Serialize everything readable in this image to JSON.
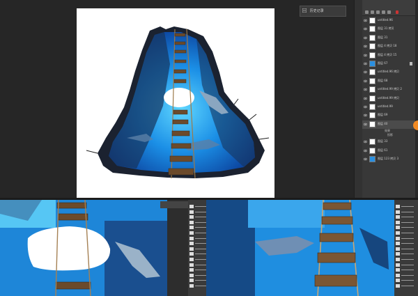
{
  "history_panel": {
    "label": "历史记录",
    "icon": "history-icon"
  },
  "layers": [
    {
      "name": "untitled.96",
      "thumb": "white",
      "selected": false,
      "lock": false
    },
    {
      "name": "图层 31 拷贝",
      "thumb": "white",
      "selected": false,
      "lock": false
    },
    {
      "name": "图层 31",
      "thumb": "white",
      "selected": false,
      "lock": false
    },
    {
      "name": "图层 4 拷贝 18",
      "thumb": "white",
      "selected": false,
      "lock": false
    },
    {
      "name": "图层 4 拷贝 15",
      "thumb": "white",
      "selected": false,
      "lock": false
    },
    {
      "name": "图层 67",
      "thumb": "blue",
      "selected": false,
      "lock": true
    },
    {
      "name": "untitled.96 拷贝",
      "thumb": "white",
      "selected": false,
      "lock": false
    },
    {
      "name": "图层 68",
      "thumb": "white",
      "selected": false,
      "lock": false
    },
    {
      "name": "untitled.99 拷贝 2",
      "thumb": "white",
      "selected": false,
      "lock": false
    },
    {
      "name": "untitled.99 拷贝",
      "thumb": "white",
      "selected": false,
      "lock": false
    },
    {
      "name": "untitled.99",
      "thumb": "white",
      "selected": false,
      "lock": false
    },
    {
      "name": "图层 69",
      "thumb": "white",
      "selected": false,
      "lock": false
    },
    {
      "name": "图层 40",
      "thumb": "white",
      "selected": true,
      "lock": false
    },
    {
      "name": "图层 33",
      "thumb": "white",
      "selected": false,
      "lock": false
    },
    {
      "name": "图层 61",
      "thumb": "white",
      "selected": false,
      "lock": false
    },
    {
      "name": "图层 123 拷贝 3",
      "thumb": "blue",
      "selected": false,
      "lock": false
    }
  ],
  "effects": {
    "title": "效果",
    "item": "投影"
  },
  "colors": {
    "water": "#1e7fd0",
    "panel": "#383838",
    "accent": "#f08a24"
  }
}
